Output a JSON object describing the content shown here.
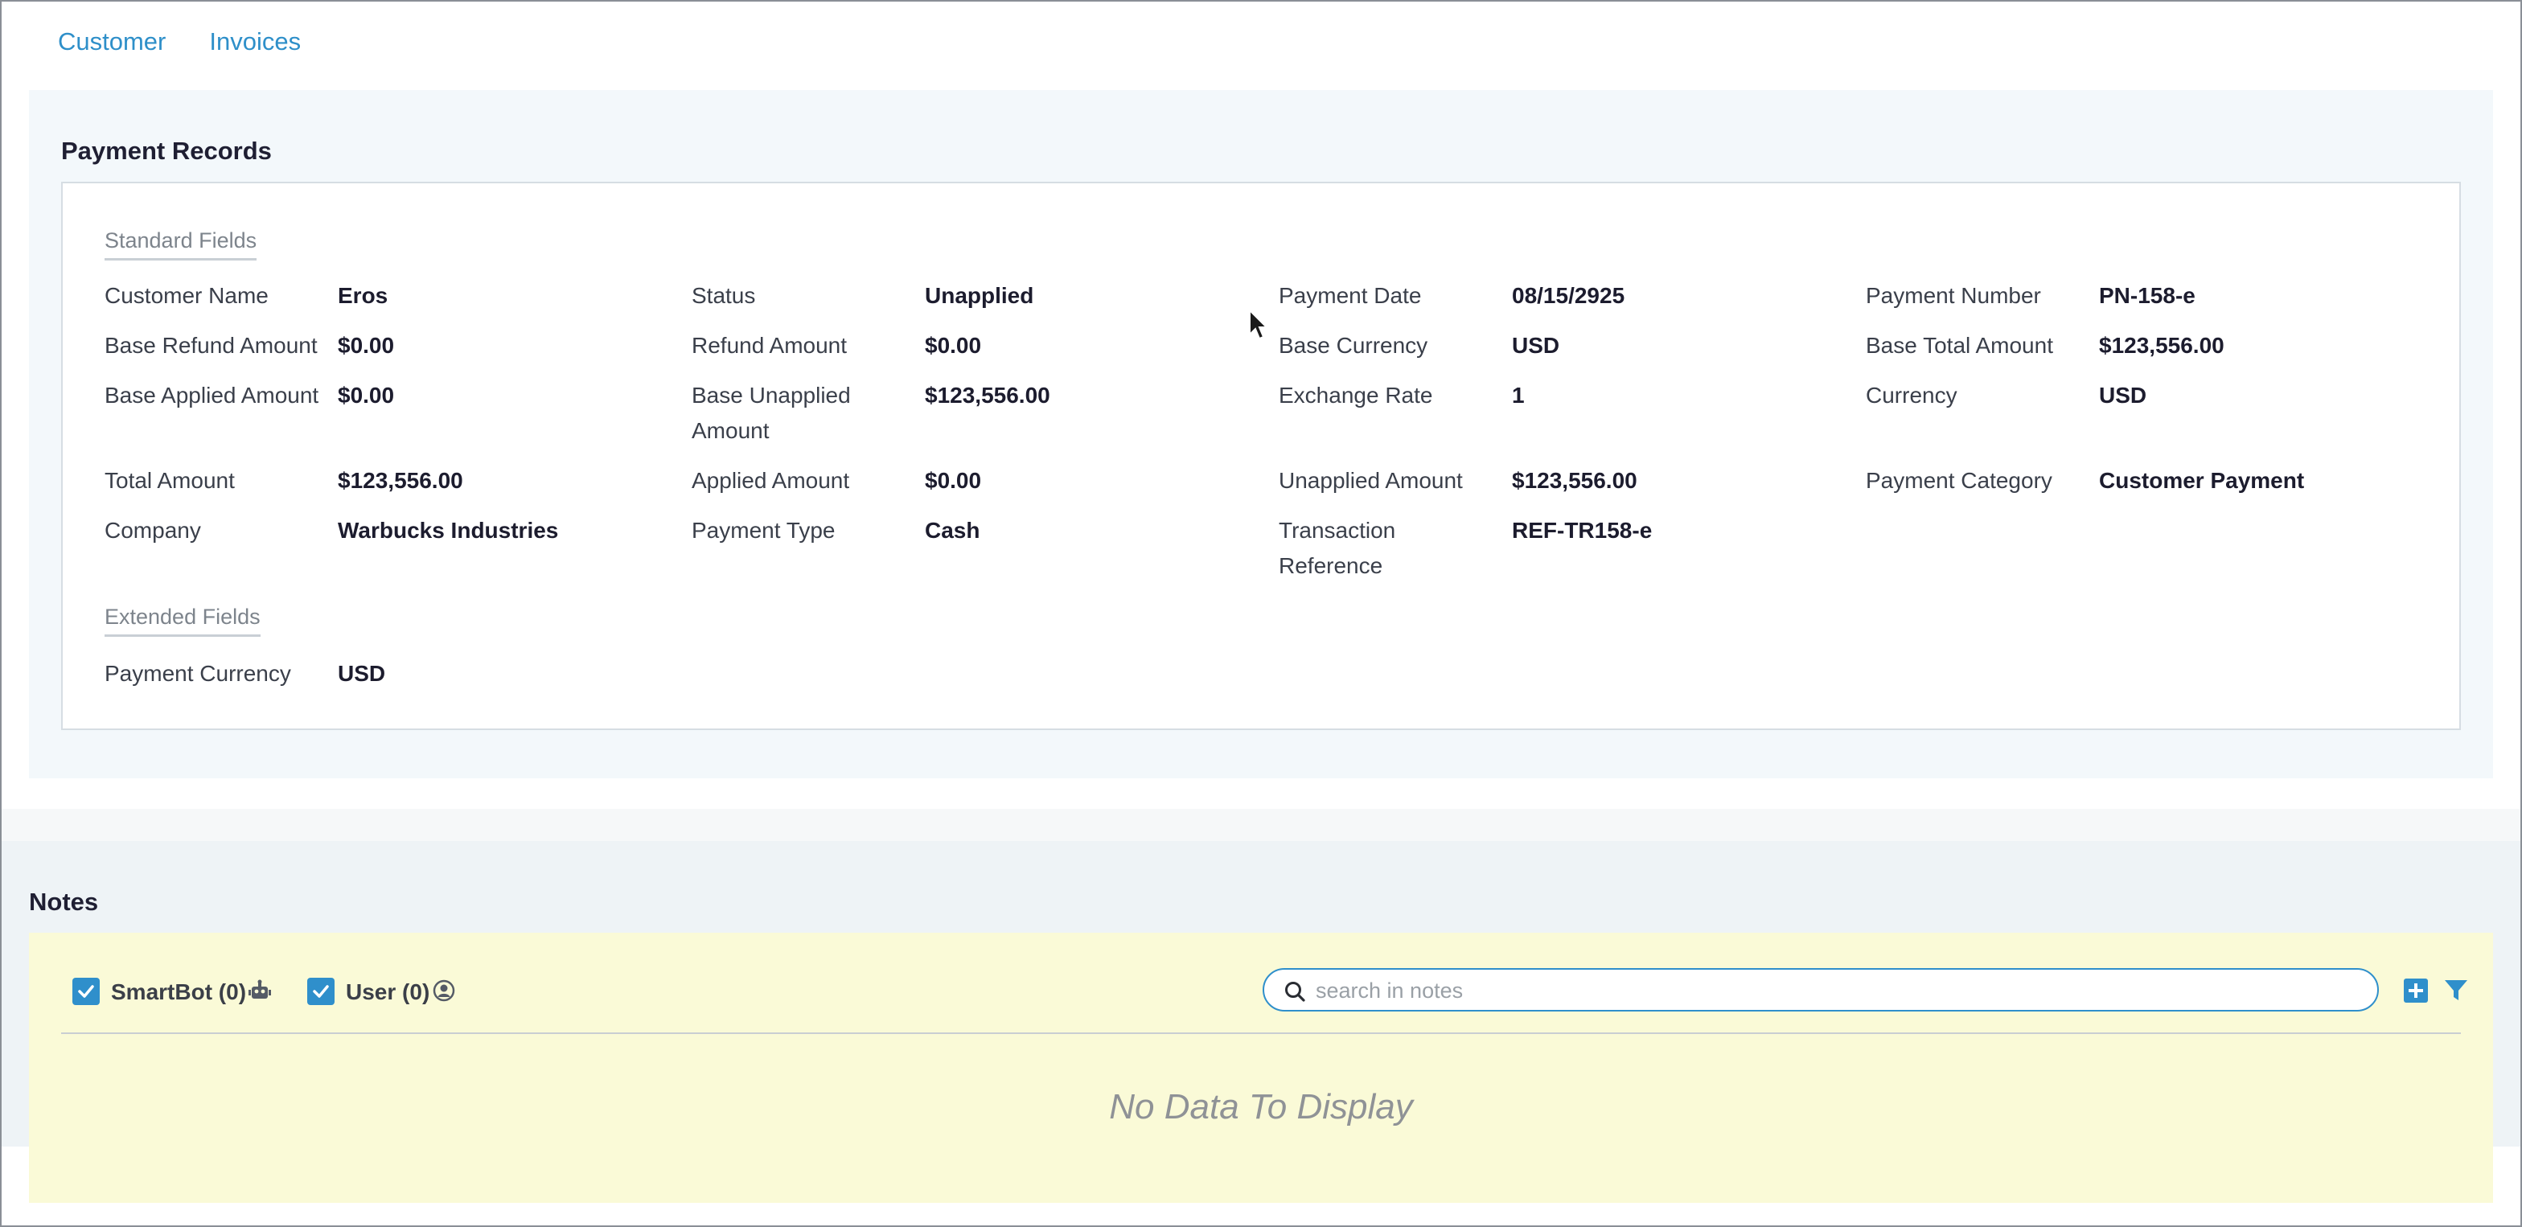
{
  "tabs": [
    {
      "label": "Customer"
    },
    {
      "label": "Invoices"
    }
  ],
  "payment_records": {
    "title": "Payment Records",
    "standard_title": "Standard Fields",
    "standard": [
      {
        "label": "Customer Name",
        "value": "Eros"
      },
      {
        "label": "Status",
        "value": "Unapplied"
      },
      {
        "label": "Payment Date",
        "value": "08/15/2925"
      },
      {
        "label": "Payment Number",
        "value": "PN-158-e"
      },
      {
        "label": "Base Refund Amount",
        "value": "$0.00"
      },
      {
        "label": "Refund Amount",
        "value": "$0.00"
      },
      {
        "label": "Base Currency",
        "value": "USD"
      },
      {
        "label": "Base Total Amount",
        "value": "$123,556.00"
      },
      {
        "label": "Base Applied Amount",
        "value": "$0.00"
      },
      {
        "label": "Base Unapplied Amount",
        "value": "$123,556.00"
      },
      {
        "label": "Exchange Rate",
        "value": "1"
      },
      {
        "label": "Currency",
        "value": "USD"
      },
      {
        "label": "Total Amount",
        "value": "$123,556.00"
      },
      {
        "label": "Applied Amount",
        "value": "$0.00"
      },
      {
        "label": "Unapplied Amount",
        "value": "$123,556.00"
      },
      {
        "label": "Payment Category",
        "value": "Customer Payment"
      },
      {
        "label": "Company",
        "value": "Warbucks Industries"
      },
      {
        "label": "Payment Type",
        "value": "Cash"
      },
      {
        "label": "Transaction Reference",
        "value": "REF-TR158-e"
      }
    ],
    "extended_title": "Extended Fields",
    "extended": [
      {
        "label": "Payment Currency",
        "value": "USD"
      }
    ]
  },
  "notes": {
    "title": "Notes",
    "smartbot_label": "SmartBot (0)",
    "user_label": "User (0)",
    "search_placeholder": "search in notes",
    "search_value": "",
    "empty_text": "No Data To Display"
  },
  "colors": {
    "accent": "#2f8fcb",
    "notes_panel": "#fafad7",
    "records_bg": "#f3f8fb"
  },
  "icons": [
    "robot-icon",
    "user-circle-icon",
    "search-icon",
    "plus-icon",
    "filter-icon",
    "checkmark-icon",
    "mouse-cursor-icon"
  ]
}
